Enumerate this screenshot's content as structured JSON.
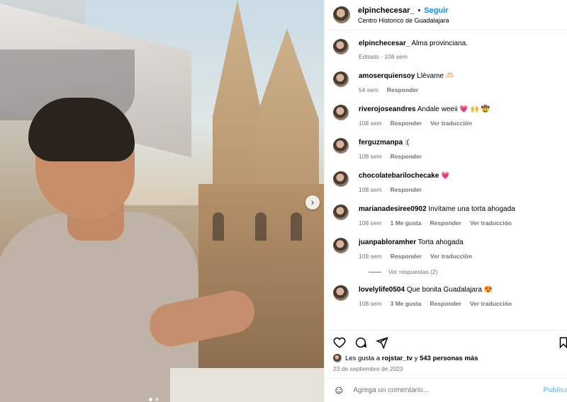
{
  "header": {
    "username": "elpinchecesar_",
    "separator": "•",
    "follow_label": "Seguir",
    "location": "Centro Historico de Guadalajara"
  },
  "caption": {
    "username": "elpinchecesar_",
    "text": "Alma provinciana.",
    "meta": "Editado · 108 sem"
  },
  "comments": [
    {
      "user": "amoserquiensoy",
      "text": "Llévame 🫶🏻",
      "time": "54 sem",
      "likes": "",
      "reply": "Responder",
      "translate": ""
    },
    {
      "user": "riverojoseandres",
      "text": "Andale weeii 💗 🙌 🤠",
      "time": "108 sem",
      "likes": "",
      "reply": "Responder",
      "translate": "Ver traducción"
    },
    {
      "user": "ferguzmanpa",
      "text": ":(",
      "time": "108 sem",
      "likes": "",
      "reply": "Responder",
      "translate": ""
    },
    {
      "user": "chocolatebarilochecake",
      "text": "💗",
      "time": "108 sem",
      "likes": "",
      "reply": "Responder",
      "translate": ""
    },
    {
      "user": "marianadesiree0902",
      "text": "Invítame una torta ahogada",
      "time": "108 sem",
      "likes": "1 Me gusta",
      "reply": "Responder",
      "translate": "Ver traducción"
    },
    {
      "user": "juanpabloramher",
      "text": "Torta ahogada",
      "time": "108 sem",
      "likes": "",
      "reply": "Responder",
      "translate": "Ver traducción"
    },
    {
      "user": "lovelylife0504",
      "text": "Que bonita Guadalajara 😍",
      "time": "108 sem",
      "likes": "3 Me gusta",
      "reply": "Responder",
      "translate": "Ver traducción"
    }
  ],
  "view_replies": "Ver respuestas (2)",
  "likes": {
    "prefix": "Les gusta a",
    "user": "rojstar_tv",
    "middle": "y",
    "others": "543 personas más"
  },
  "date": "23 de septiembre de 2023",
  "add_comment": {
    "placeholder": "Agrega un comentario...",
    "post_label": "Publicar"
  },
  "icons": [
    "heart-icon",
    "comment-icon",
    "share-icon",
    "bookmark-icon",
    "emoji-icon",
    "chevron-right-icon"
  ],
  "colors": {
    "accent": "#0095f6",
    "muted": "#737373"
  }
}
